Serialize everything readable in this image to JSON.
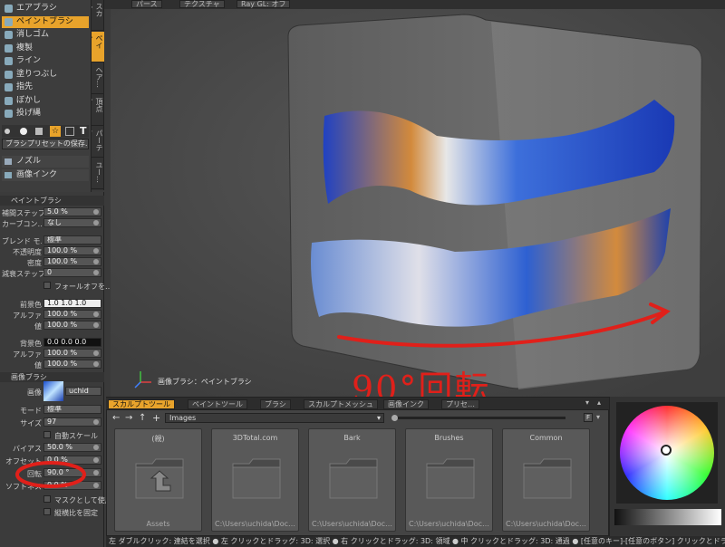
{
  "tools": [
    {
      "label": "エアブラシ",
      "icon": "airbrush-icon"
    },
    {
      "label": "ペイントブラシ",
      "icon": "paintbrush-icon",
      "selected": true
    },
    {
      "label": "消しゴム",
      "icon": "eraser-icon"
    },
    {
      "label": "複製",
      "icon": "clone-icon"
    },
    {
      "label": "ライン",
      "icon": "line-icon"
    },
    {
      "label": "塗りつぶし",
      "icon": "fill-icon"
    },
    {
      "label": "指先",
      "icon": "smudge-icon"
    },
    {
      "label": "ぼかし",
      "icon": "blur-icon"
    },
    {
      "label": "投げ縄",
      "icon": "lasso-icon"
    }
  ],
  "vtabs": [
    "スカル…",
    "ペイン…",
    "ヘア…",
    "頂点マ…",
    "パーティ…",
    "ユー…"
  ],
  "brush_preset_button": "ブラシプリセットの保存…",
  "nozzle_label": "ノズル",
  "image_ink_label": "画像インク",
  "section_paintbrush": "ペイントブラシ",
  "fields": {
    "interp_step": {
      "label": "補間ステップ",
      "value": "5.0 %"
    },
    "curve": {
      "label": "カーブコン…",
      "value": "なし"
    },
    "blend": {
      "label": "ブレンド モ…",
      "value": "標準"
    },
    "opacity": {
      "label": "不透明度",
      "value": "100.0 %"
    },
    "density": {
      "label": "密度",
      "value": "100.0 %"
    },
    "fade_step": {
      "label": "減衰ステップ",
      "value": "0"
    },
    "falloff_label": "フォールオフを…",
    "fg": {
      "label": "前景色",
      "value": "1.0  1.0  1.0"
    },
    "fg_alpha": {
      "label": "アルファ",
      "value": "100.0 %"
    },
    "fg_value": {
      "label": "値",
      "value": "100.0 %"
    },
    "bg": {
      "label": "背景色",
      "value": "0.0  0.0  0.0"
    },
    "bg_alpha": {
      "label": "アルファ",
      "value": "100.0 %"
    },
    "bg_value": {
      "label": "値",
      "value": "100.0 %"
    }
  },
  "section_image_brush": "画像ブラシ",
  "image_brush": {
    "image_label": "画像",
    "image_name": "uchid",
    "mode_label": "モード",
    "mode_value": "標準",
    "size_label": "サイズ",
    "size_value": "97",
    "auto_scale": "自動スケール",
    "bias_label": "バイアス",
    "bias_value": "50.0 %",
    "offset_label": "オフセット",
    "offset_value": "0.0 %",
    "rotation_label": "回転",
    "rotation_value": "90.0 °",
    "softness_label": "ソフトネス",
    "softness_value": "0.0 %",
    "use_as_mask": "マスクとして使用",
    "lock_aspect": "縦横比を固定"
  },
  "topbar": [
    "パース",
    "テクスチャ",
    "Ray GL: オフ"
  ],
  "viewport_label": "画像ブラシ：ペイントブラシ",
  "annotation": "90°回転",
  "bottom_tabs": [
    "スカルプトツール",
    "ペイントツール",
    "ブラシ",
    "スカルプトメッシュ",
    "画像インク",
    "プリセ…"
  ],
  "browser_path": "Images",
  "folders": [
    {
      "name": "(親)",
      "path": "Assets"
    },
    {
      "name": "3DTotal.com",
      "path": "C:\\Users\\uchida\\Doc…"
    },
    {
      "name": "Bark",
      "path": "C:\\Users\\uchida\\Doc…"
    },
    {
      "name": "Brushes",
      "path": "C:\\Users\\uchida\\Doc…"
    },
    {
      "name": "Common",
      "path": "C:\\Users\\uchida\\Doc…"
    }
  ],
  "status": "左 ダブルクリック: 連結を選択 ● 左 クリックとドラッグ: 3D: 選択 ● 右 クリックとドラッグ: 3D: 領域 ● 中 クリックとドラッグ: 3D: 通過 ● [任意のキー]-[任意のボタン] クリックとドラッグ: dragDropBegin",
  "colors": {
    "accent": "#e8a32b",
    "annotation": "#e0201a"
  }
}
